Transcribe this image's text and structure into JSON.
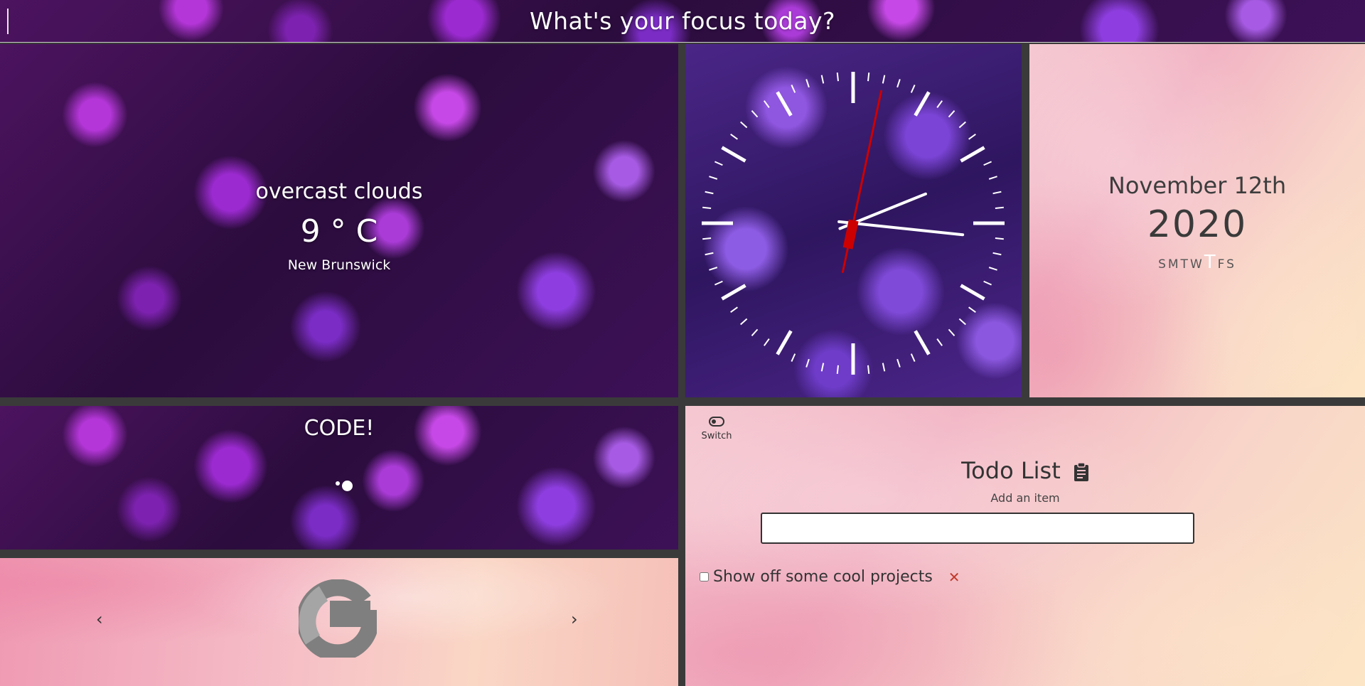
{
  "focus": {
    "title": "What's your focus today?"
  },
  "weather": {
    "description": "overcast clouds",
    "temperature": "9 ° C",
    "location": "New Brunswick"
  },
  "clock": {
    "hour": 2,
    "minute": 16,
    "second": 2
  },
  "date": {
    "month_day": "November 12th",
    "year": "2020",
    "weekdays": [
      "S",
      "M",
      "T",
      "W",
      "T",
      "F",
      "S"
    ],
    "today_index": 4
  },
  "code": {
    "title": "CODE!"
  },
  "carousel": {
    "prev_label": "‹",
    "next_label": "›",
    "logo": "google-g-logo"
  },
  "todo": {
    "switch_label": "Switch",
    "title": "Todo List",
    "subtitle": "Add an item",
    "input_value": "",
    "items": [
      {
        "text": "Show off some cool projects",
        "checked": false
      }
    ],
    "delete_label": "✕"
  },
  "colors": {
    "accent_red": "#c0392b",
    "second_hand": "#cc0000"
  },
  "icons": [
    "clipboard-icon",
    "toggle-switch-icon",
    "close-icon",
    "chevron-left-icon",
    "chevron-right-icon",
    "google-g-logo"
  ]
}
